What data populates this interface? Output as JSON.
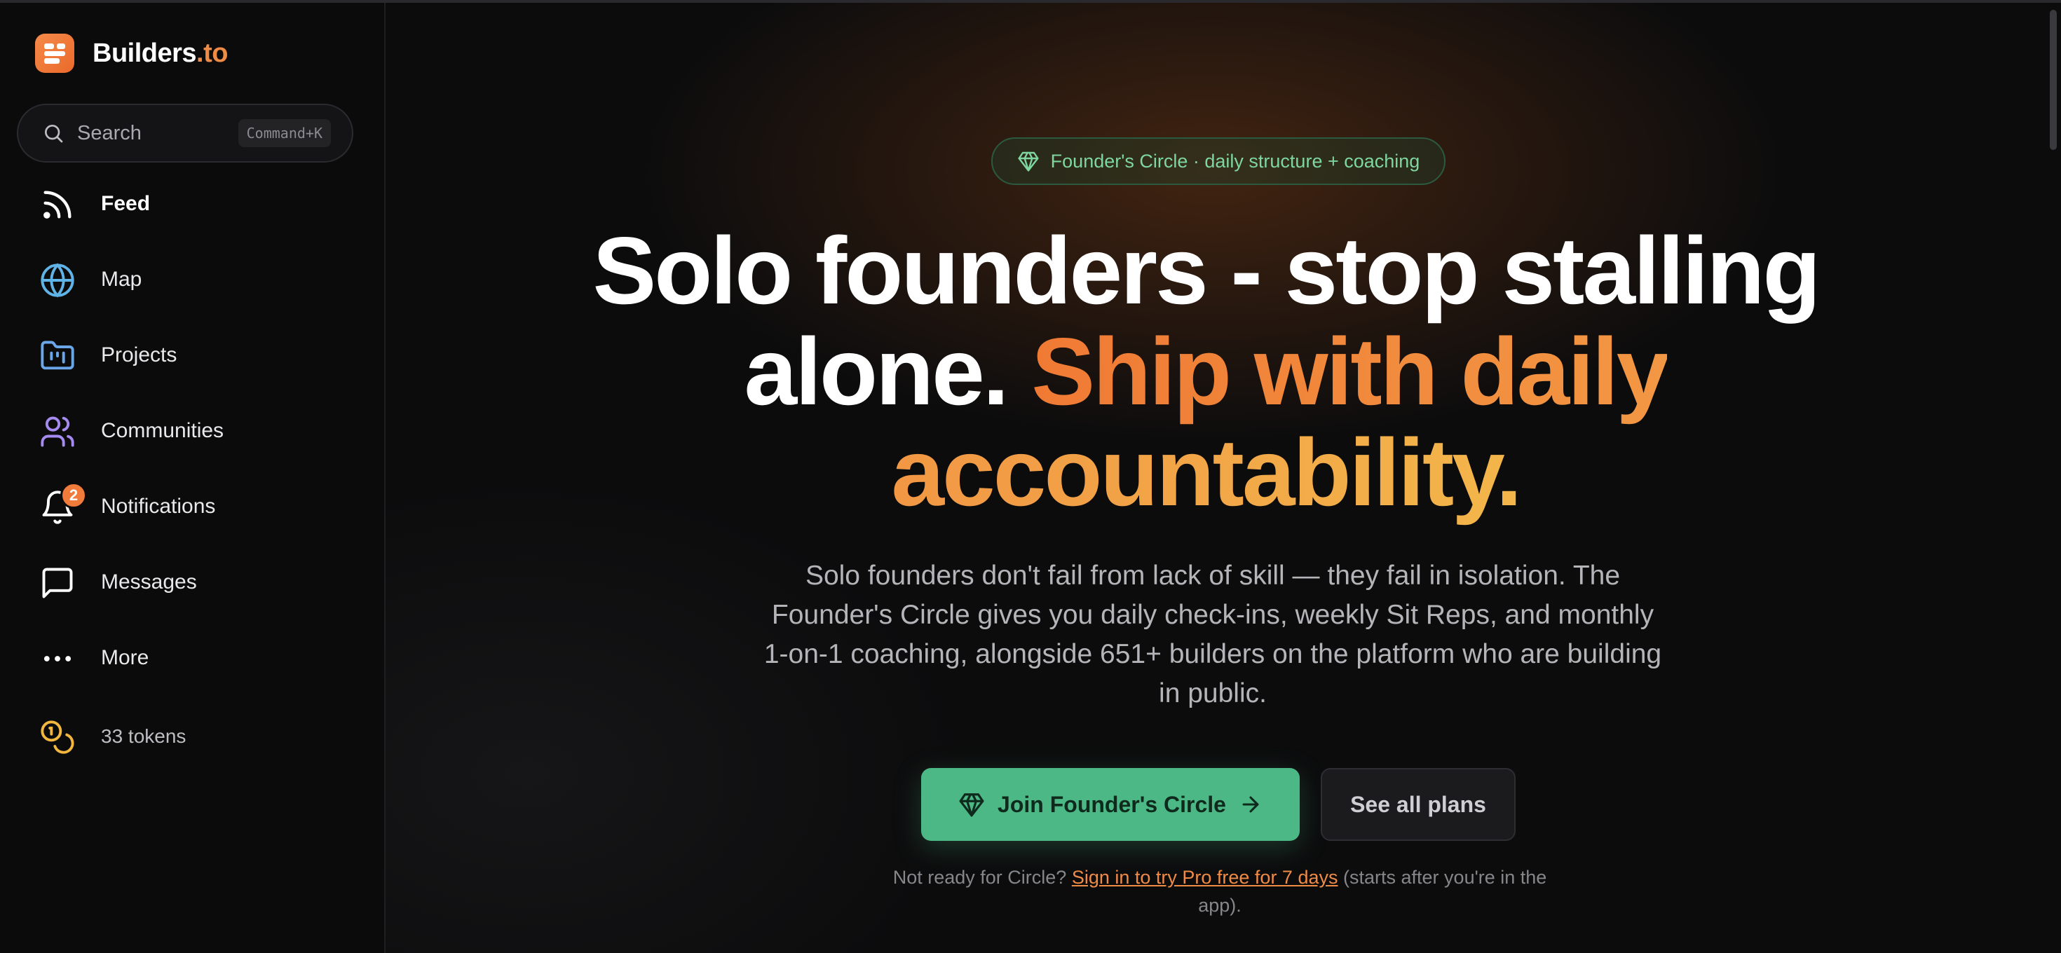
{
  "brand": {
    "name_main": "Builders",
    "name_suffix": ".to",
    "accent_color": "#f08b45"
  },
  "search": {
    "placeholder": "Search",
    "shortcut": "Command+K"
  },
  "nav": {
    "items": [
      {
        "label": "Feed",
        "icon": "rss-icon",
        "active": true
      },
      {
        "label": "Map",
        "icon": "globe-icon"
      },
      {
        "label": "Projects",
        "icon": "folder-kanban-icon"
      },
      {
        "label": "Communities",
        "icon": "users-icon"
      },
      {
        "label": "Notifications",
        "icon": "bell-icon",
        "badge": "2"
      },
      {
        "label": "Messages",
        "icon": "message-square-icon"
      },
      {
        "label": "More",
        "icon": "ellipsis-icon"
      },
      {
        "label": "33 tokens",
        "icon": "coins-icon"
      }
    ]
  },
  "hero": {
    "pill_text": "Founder's Circle · daily structure + coaching",
    "headline_white": "Solo founders - stop stalling alone.",
    "headline_orange": "Ship with daily accountability.",
    "lead": "Solo founders don't fail from lack of skill — they fail in isolation. The Founder's Circle gives you daily check-ins, weekly Sit Reps, and monthly 1-on-1 coaching, alongside 651+ builders on the platform who are building in public.",
    "primary_cta": "Join Founder's Circle",
    "secondary_cta": "See all plans",
    "footnote_prefix": "Not ready for Circle?",
    "footnote_link": "Sign in to try Pro free for 7 days",
    "footnote_suffix": "(starts after you're in the app)."
  },
  "colors": {
    "primary_green": "#4cb886",
    "pill_green_text": "#7fd69e",
    "badge_orange": "#f07b3a"
  }
}
